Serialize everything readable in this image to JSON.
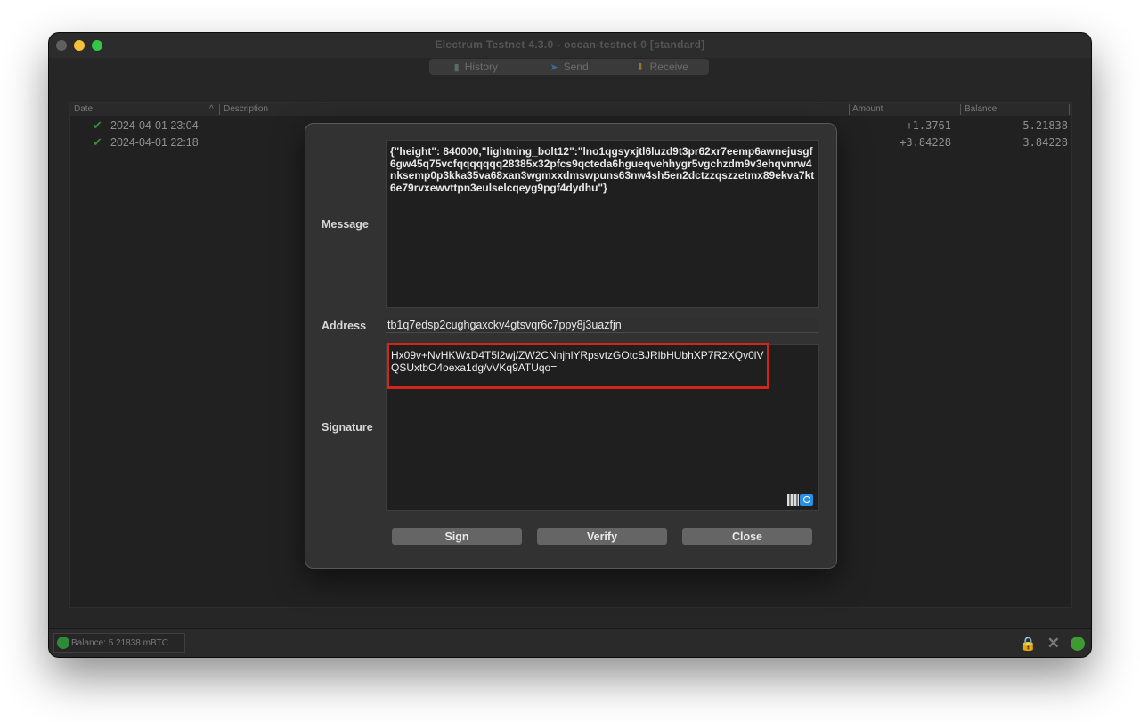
{
  "window": {
    "title": "Electrum Testnet 4.3.0  -  ocean-testnet-0  [standard]"
  },
  "tabs": [
    {
      "label": "History",
      "icon": "history-icon"
    },
    {
      "label": "Send",
      "icon": "send-icon"
    },
    {
      "label": "Receive",
      "icon": "receive-icon"
    }
  ],
  "history": {
    "columns": {
      "date": "Date",
      "sort_indicator": "^",
      "description": "Description",
      "amount": "Amount",
      "balance": "Balance"
    },
    "rows": [
      {
        "date": "2024-04-01 23:04",
        "amount": "+1.3761",
        "balance": "5.21838",
        "status_icon": "confirmed-check-icon"
      },
      {
        "date": "2024-04-01 22:18",
        "amount": "+3.84228",
        "balance": "3.84228",
        "status_icon": "confirmed-check-icon"
      }
    ]
  },
  "dialog": {
    "message_label": "Message",
    "message_value": "{\"height\": 840000,\"lightning_bolt12\":\"lno1qgsyxjtl6luzd9t3pr62xr7eemp6awnejusgf6gw45q75vcfqqqqqqq28385x32pfcs9qcteda6hgueqvehhygr5vgchzdm9v3ehqvnrw4nksemp0p3kka35va68xan3wgmxxdmswpuns63nw4sh5en2dctzzqszzetmx89ekva7kt6e79rvxewvttpn3eulselcqeyg9pgf4dydhu\"}",
    "address_label": "Address",
    "address_value": "tb1q7edsp2cughgaxckv4gtsvqr6c7ppy8j3uazfjn",
    "signature_label": "Signature",
    "signature_value": "Hx09v+NvHKWxD4T5l2wj/ZW2CNnjhlYRpsvtzGOtcBJRlbHUbhXP7R2XQv0lVQSUxtbO4oexa1dg/vVKq9ATUqo=",
    "buttons": {
      "sign": "Sign",
      "verify": "Verify",
      "close": "Close"
    },
    "highlight_color": "#d3251a"
  },
  "statusbar": {
    "balance": "Balance: 5.21838 mBTC",
    "network_status_color": "#3e9a33"
  }
}
